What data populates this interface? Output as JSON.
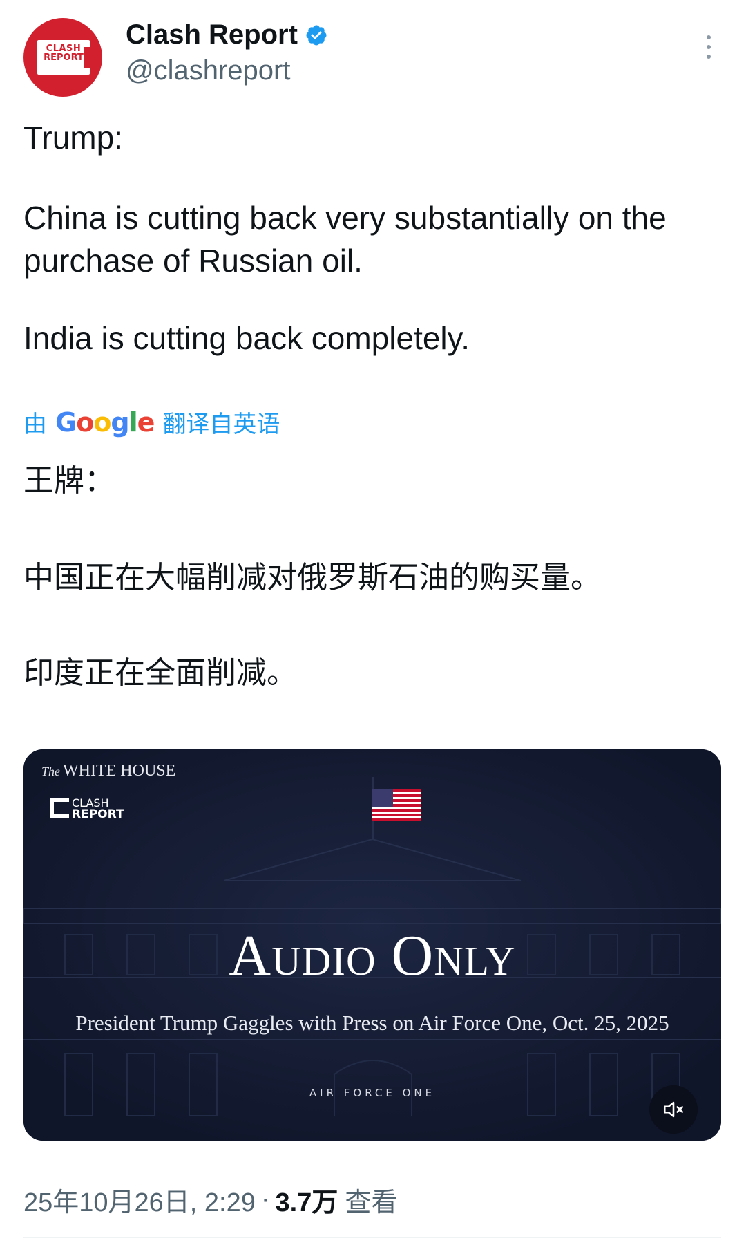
{
  "author": {
    "display_name": "Clash Report",
    "handle": "@clashreport",
    "avatar_line1": "CLASH",
    "avatar_line2": "REPORT",
    "verified": true
  },
  "tweet": {
    "p1": "Trump:",
    "p2": "China is cutting back very substantially on the purchase of Russian oil.",
    "p3": "India is cutting back completely."
  },
  "translation": {
    "prefix": "由",
    "brand": "Google",
    "suffix": "翻译自英语",
    "p1": "王牌：",
    "p2": "中国正在大幅削减对俄罗斯石油的购买量。",
    "p3": "印度正在全面削减。"
  },
  "media": {
    "top_label_the": "The",
    "top_label_main": "WHITE HOUSE",
    "logo_line1": "CLASH",
    "logo_line2": "REPORT",
    "title": "Audio Only",
    "subtitle": "President Trump Gaggles with Press on Air Force One, Oct. 25, 2025",
    "tag": "AIR FORCE ONE"
  },
  "meta": {
    "timestamp": "25年10月26日, 2:29",
    "separator": "·",
    "views_count": "3.7万",
    "views_label": "查看"
  },
  "colors": {
    "link_blue": "#1d9bf0",
    "brand_red": "#d3202f",
    "secondary_gray": "#536471",
    "card_bg": "#141b31"
  }
}
